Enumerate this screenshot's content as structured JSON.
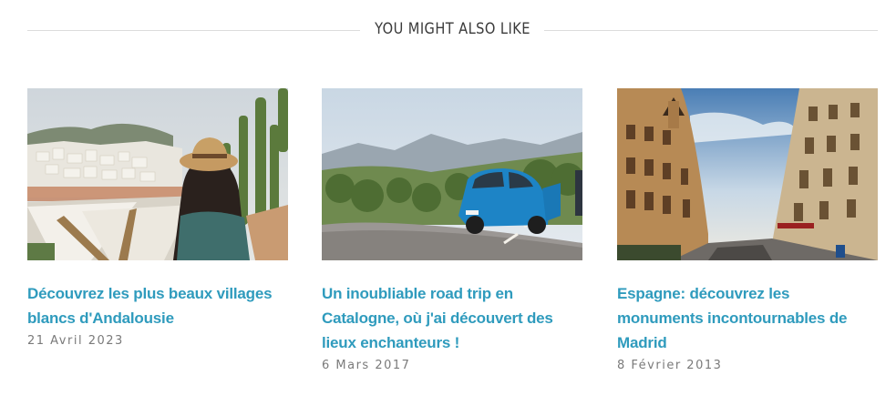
{
  "section": {
    "title": "YOU MIGHT ALSO LIKE"
  },
  "posts": [
    {
      "title": "Découvrez les plus beaux villages blancs d'Andalousie",
      "date": "21 Avril 2023",
      "image_icon": "andalusia-village-photo"
    },
    {
      "title": "Un inoubliable road trip en Catalogne, où j'ai découvert des lieux enchanteurs !",
      "date": "6 Mars 2017",
      "image_icon": "catalonia-road-trip-photo"
    },
    {
      "title": "Espagne: découvrez les monuments incontournables de Madrid",
      "date": "8 Février 2013",
      "image_icon": "madrid-monuments-photo"
    }
  ],
  "colors": {
    "link": "#2f9bbd",
    "date": "#7a7a7a",
    "rule": "#dcdcdc",
    "heading": "#3a3a3a"
  }
}
